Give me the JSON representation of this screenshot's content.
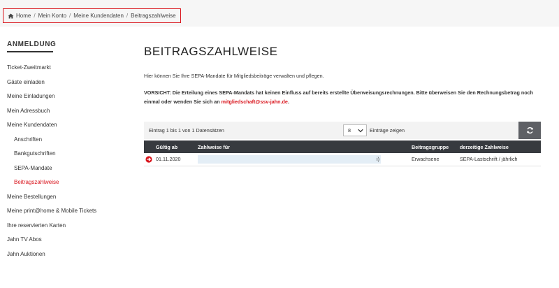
{
  "breadcrumb": {
    "items": [
      "Home",
      "Mein Konto",
      "Meine Kundendaten",
      "Beitragszahlweise"
    ],
    "separator": "/"
  },
  "sidebar": {
    "title": "ANMELDUNG",
    "items": [
      {
        "label": "Ticket-Zweitmarkt"
      },
      {
        "label": "Gäste einladen"
      },
      {
        "label": "Meine Einladungen"
      },
      {
        "label": "Mein Adressbuch"
      },
      {
        "label": "Meine Kundendaten"
      },
      {
        "label": "Anschriften"
      },
      {
        "label": "Bankgutschriften"
      },
      {
        "label": "SEPA-Mandate"
      },
      {
        "label": "Beitragszahlweise"
      },
      {
        "label": "Meine Bestellungen"
      },
      {
        "label": "Meine print@home & Mobile Tickets"
      },
      {
        "label": "Ihre reservierten Karten"
      },
      {
        "label": "Jahn TV Abos"
      },
      {
        "label": "Jahn Auktionen"
      }
    ]
  },
  "main": {
    "title": "BEITRAGSZAHLWEISE",
    "intro": "Hier können Sie Ihre SEPA-Mandate für Mitgliedsbeiträge verwalten und pflegen.",
    "warning": "VORSICHT: Die Erteilung eines SEPA-Mandats hat keinen Einfluss auf bereits erstellte Überweisungsrechnungen. Bitte überweisen Sie den Rechnungsbetrag noch einmal oder wenden Sie sich an",
    "email": "mitgliedschaft@ssv-jahn.de",
    "email_suffix": "."
  },
  "table": {
    "info": "Eintrag 1 bis 1 von 1 Datensätzen",
    "page_length": "8",
    "page_length_label": "Einträge zeigen",
    "columns": [
      "Gültig ab",
      "Zahlweise für",
      "Beitragsgruppe",
      "derzeitige Zahlweise"
    ],
    "rows": [
      {
        "gueltig_ab": "01.11.2020",
        "zahlweise_tail": "i)",
        "beitragsgruppe": "Erwachsene",
        "zahlweise": "SEPA-Lastschrift / jährlich"
      }
    ]
  },
  "colors": {
    "accent": "#d9141c",
    "header_dark": "#373a3f",
    "refresh_button": "#5e6065"
  },
  "icons": {
    "home": "home-icon",
    "refresh": "refresh-icon",
    "expand": "expand-row-icon",
    "dropdown": "chevron-down-icon"
  }
}
